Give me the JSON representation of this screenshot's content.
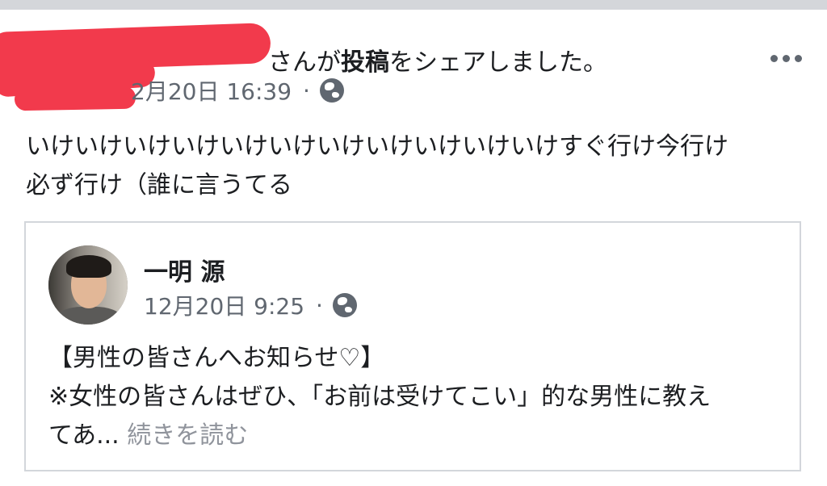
{
  "share_header": {
    "suffix_pre": "さんが",
    "suffix_bold": "投稿",
    "suffix_post": "をシェアしました。"
  },
  "post": {
    "timestamp": "2月20日 16:39",
    "separator": "·",
    "text_line1": "いけいけいけいけいけいけいけいけいけいけいけすぐ行け今行け",
    "text_line2": "必ず行け（誰に言うてる",
    "more_icon": "more-options-icon",
    "privacy_icon": "globe-icon"
  },
  "shared_post": {
    "author": "一明 源",
    "timestamp": "12月20日 9:25",
    "separator": "·",
    "line1": "【男性の皆さんへお知らせ♡】",
    "line2": "※女性の皆さんはぜひ、「お前は受けてこい」的な男性に教え",
    "line3": "てあ...",
    "see_more": "続きを読む",
    "privacy_icon": "globe-icon"
  },
  "colors": {
    "text": "#1c1e21",
    "meta": "#606770",
    "see_more": "#90949c",
    "redaction": "#f23a4c",
    "card_border": "#d3d6db"
  }
}
